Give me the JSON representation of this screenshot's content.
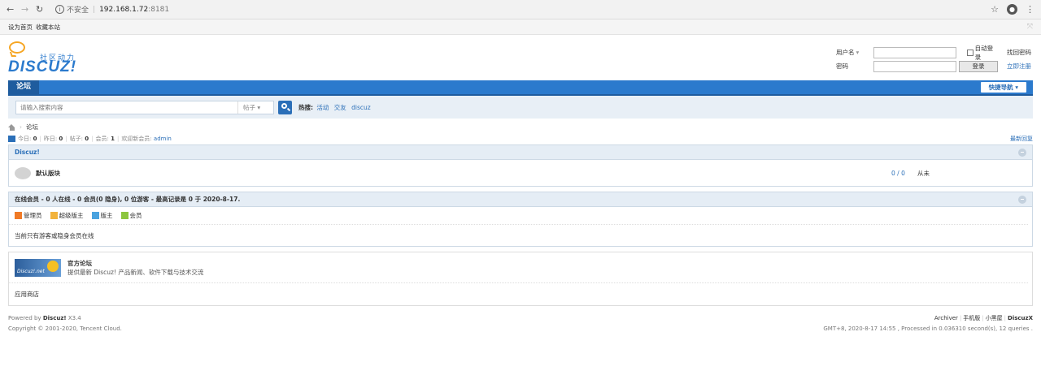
{
  "browser": {
    "security": "不安全",
    "host": "192.168.1.72",
    "port": ":8181"
  },
  "topbar": {
    "set_home": "设为首页",
    "bookmark": "收藏本站"
  },
  "logo": {
    "slogan": "社区动力",
    "brand": "DISCUZ!"
  },
  "login": {
    "username_label": "用户名",
    "password_label": "密码",
    "auto_login": "自动登录",
    "login_button": "登录",
    "find_password": "找回密码",
    "register": "立即注册"
  },
  "nav": {
    "forum_tab": "论坛",
    "quick_nav": "快捷导航 ▾"
  },
  "search": {
    "placeholder": "请输入搜索内容",
    "type": "帖子 ▾",
    "hot_label": "热搜:",
    "hot_terms": [
      "活动",
      "交友",
      "discuz"
    ]
  },
  "breadcrumb": {
    "arrow": "›",
    "current": "论坛"
  },
  "stats": {
    "today_label": "今日:",
    "today": "0",
    "yesterday_label": "昨日:",
    "yesterday": "0",
    "posts_label": "帖子:",
    "posts": "0",
    "members_label": "会员:",
    "members": "1",
    "welcome_label": "欢迎新会员:",
    "newest": "admin",
    "latest_reply": "最新回复"
  },
  "forum_group": {
    "title": "Discuz!",
    "forum_name": "默认版块",
    "counts": "0 / 0",
    "last_post": "从未"
  },
  "online": {
    "title": "在线会员 - 0 人在线 - 0 会员(0 隐身), 0 位游客 - 最高记录是 0 于 2020-8-17.",
    "legend": [
      {
        "label": "管理员",
        "color": "#f07a26"
      },
      {
        "label": "超级版主",
        "color": "#f2b33c"
      },
      {
        "label": "版主",
        "color": "#4aa3df"
      },
      {
        "label": "会员",
        "color": "#8cc63f"
      }
    ],
    "message": "当前只有游客或隐身会员在线"
  },
  "links": {
    "banner_text": "Discuz!.net",
    "title": "官方论坛",
    "desc": "提供最新 Discuz! 产品新闻、软件下载与技术交流",
    "app_store": "应用商店"
  },
  "footer": {
    "powered_prefix": "Powered by",
    "powered_brand": "Discuz!",
    "version": "X3.4",
    "copyright": "Copyright © 2001-2020, Tencent Cloud.",
    "archiver": "Archiver",
    "mobile": "手机版",
    "blackroom": "小黑屋",
    "discuzx": "DiscuzX",
    "processed": "GMT+8, 2020-8-17 14:55 , Processed in 0.036310 second(s), 12 queries ."
  }
}
